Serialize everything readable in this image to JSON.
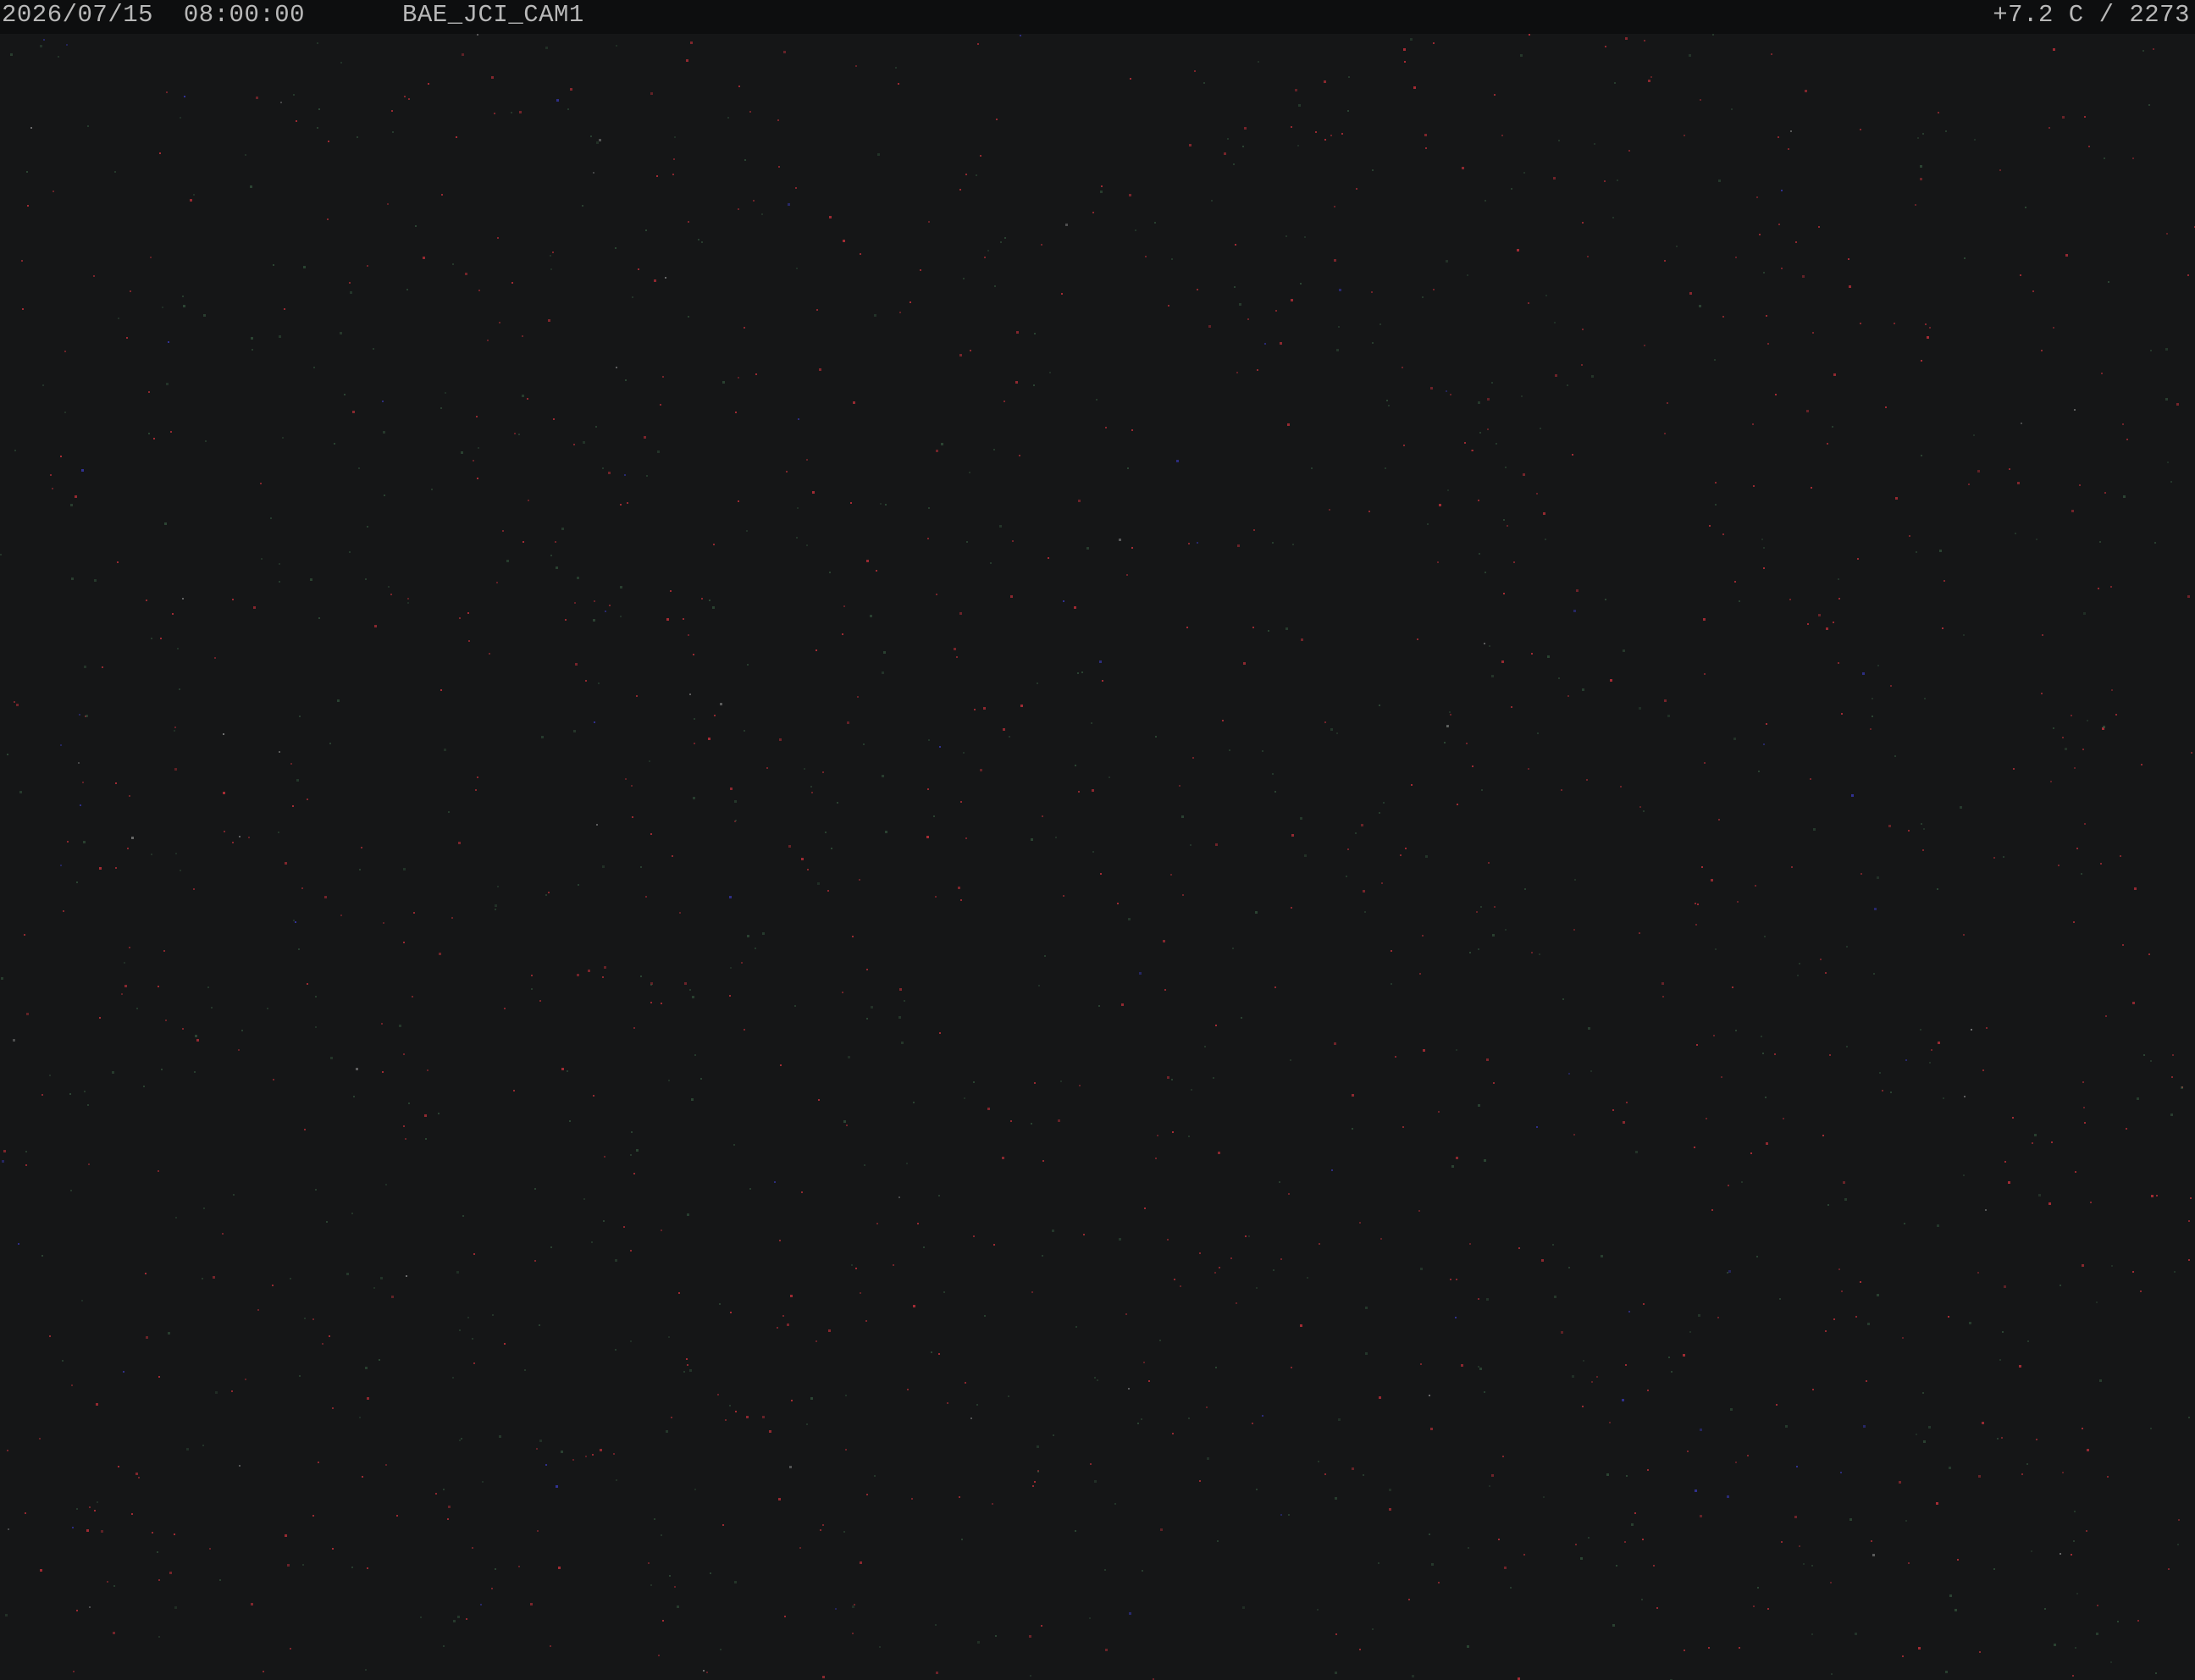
{
  "overlay": {
    "date": "2026/07/15",
    "time": "08:00:00",
    "camera_id": "BAE_JCI_CAM1",
    "status": "+7.2 C / 2273"
  },
  "colors": {
    "background": "#151617",
    "overlay_bar": "#0d0e0f",
    "overlay_text": "#b8b8b8",
    "noise_red": "#c0303a",
    "noise_green": "#3f6b4a",
    "noise_blue": "#3a3ab8"
  }
}
